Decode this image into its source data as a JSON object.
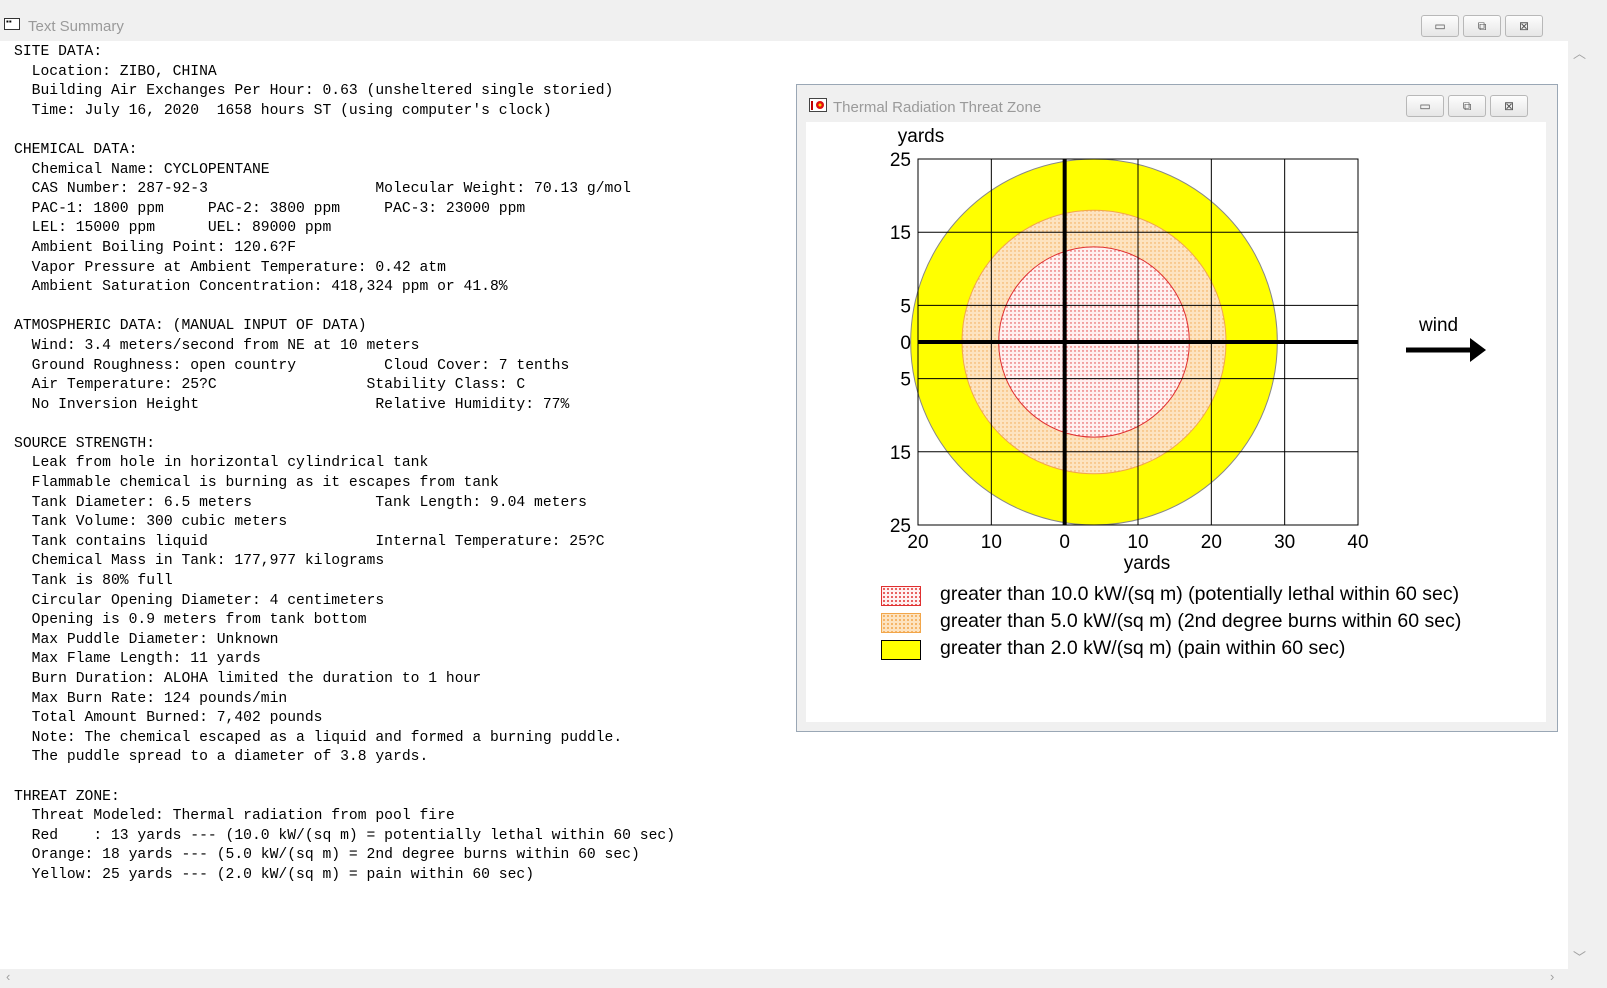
{
  "main_window": {
    "title": "Text Summary",
    "controls": {
      "minimize": "▭",
      "maximize": "⧉",
      "close": "⊠"
    }
  },
  "summary_lines": [
    "SITE DATA:",
    "  Location: ZIBO, CHINA",
    "  Building Air Exchanges Per Hour: 0.63 (unsheltered single storied)",
    "  Time: July 16, 2020  1658 hours ST (using computer's clock)",
    "",
    "CHEMICAL DATA:",
    "  Chemical Name: CYCLOPENTANE",
    "  CAS Number: 287-92-3                   Molecular Weight: 70.13 g/mol",
    "  PAC-1: 1800 ppm     PAC-2: 3800 ppm     PAC-3: 23000 ppm",
    "  LEL: 15000 ppm      UEL: 89000 ppm",
    "  Ambient Boiling Point: 120.6?F",
    "  Vapor Pressure at Ambient Temperature: 0.42 atm",
    "  Ambient Saturation Concentration: 418,324 ppm or 41.8%",
    "",
    "ATMOSPHERIC DATA: (MANUAL INPUT OF DATA)",
    "  Wind: 3.4 meters/second from NE at 10 meters",
    "  Ground Roughness: open country          Cloud Cover: 7 tenths",
    "  Air Temperature: 25?C                 Stability Class: C",
    "  No Inversion Height                    Relative Humidity: 77%",
    "",
    "SOURCE STRENGTH:",
    "  Leak from hole in horizontal cylindrical tank",
    "  Flammable chemical is burning as it escapes from tank",
    "  Tank Diameter: 6.5 meters              Tank Length: 9.04 meters",
    "  Tank Volume: 300 cubic meters",
    "  Tank contains liquid                   Internal Temperature: 25?C",
    "  Chemical Mass in Tank: 177,977 kilograms",
    "  Tank is 80% full",
    "  Circular Opening Diameter: 4 centimeters",
    "  Opening is 0.9 meters from tank bottom",
    "  Max Puddle Diameter: Unknown",
    "  Max Flame Length: 11 yards",
    "  Burn Duration: ALOHA limited the duration to 1 hour",
    "  Max Burn Rate: 124 pounds/min",
    "  Total Amount Burned: 7,402 pounds",
    "  Note: The chemical escaped as a liquid and formed a burning puddle.",
    "  The puddle spread to a diameter of 3.8 yards.",
    "",
    "THREAT ZONE:",
    "  Threat Modeled: Thermal radiation from pool fire",
    "  Red    : 13 yards --- (10.0 kW/(sq m) = potentially lethal within 60 sec)",
    "  Orange: 18 yards --- (5.0 kW/(sq m) = 2nd degree burns within 60 sec)",
    "  Yellow: 25 yards --- (2.0 kW/(sq m) = pain within 60 sec)"
  ],
  "thermal_window": {
    "title": "Thermal Radiation Threat Zone",
    "controls": {
      "minimize": "▭",
      "maximize": "⧉",
      "close": "⊠"
    },
    "wind_label": "wind"
  },
  "chart_data": {
    "type": "threat-zone-map",
    "title": "Thermal Radiation Threat Zone",
    "x_label": "yards",
    "y_label": "yards",
    "x_ticks": [
      {
        "value": -20,
        "label": "20"
      },
      {
        "value": -10,
        "label": "10"
      },
      {
        "value": 0,
        "label": "0"
      },
      {
        "value": 10,
        "label": "10"
      },
      {
        "value": 20,
        "label": "20"
      },
      {
        "value": 30,
        "label": "30"
      },
      {
        "value": 40,
        "label": "40"
      }
    ],
    "y_ticks": [
      {
        "value": 25,
        "label": "25"
      },
      {
        "value": 15,
        "label": "15"
      },
      {
        "value": 5,
        "label": "5"
      },
      {
        "value": 0,
        "label": "0"
      },
      {
        "value": -5,
        "label": "5"
      },
      {
        "value": -15,
        "label": "15"
      },
      {
        "value": -25,
        "label": "25"
      }
    ],
    "xlim": [
      -20,
      40
    ],
    "ylim": [
      -25,
      25
    ],
    "grid": true,
    "wind_direction": "east",
    "zones": [
      {
        "name": "Yellow",
        "center_x": 4,
        "radius": 25,
        "fill": "#ffff00",
        "stroke": "#888888",
        "label": "greater than 2.0 kW/(sq m) (pain within 60 sec)"
      },
      {
        "name": "Orange",
        "center_x": 4,
        "radius": 18,
        "fill": "#fde3c0",
        "stroke": "#f2a64a",
        "label": "greater than 5.0 kW/(sq m) (2nd degree burns within 60 sec)"
      },
      {
        "name": "Red",
        "center_x": 4,
        "radius": 13,
        "fill": "#fff0f0",
        "stroke": "#e03030",
        "label": "greater than 10.0 kW/(sq m) (potentially lethal within 60 sec)"
      }
    ]
  }
}
